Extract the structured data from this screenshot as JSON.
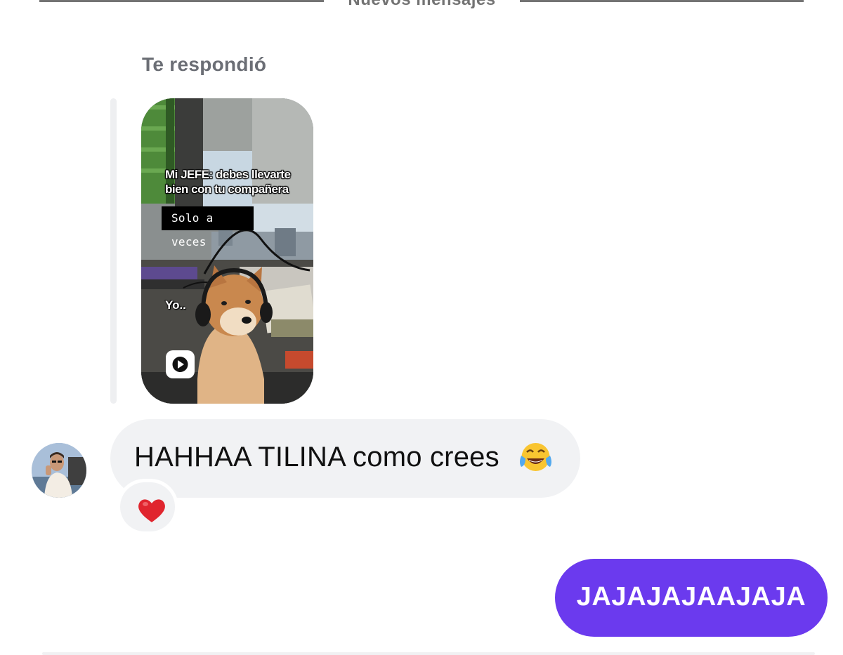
{
  "divider": {
    "label": "Nuevos mensajes"
  },
  "reply": {
    "label": "Te respondió",
    "reel": {
      "caption_line1": "Mi JEFE: debes llevarte",
      "caption_line2": "bien con tu compañera",
      "overlay_text": "Solo a veces",
      "yo_text": "Yo..",
      "play_icon": "play-icon"
    }
  },
  "incoming": {
    "text": "HAHHAA TILINA como crees",
    "emoji": "face-with-tears-of-joy-icon",
    "reaction": "red-heart-icon"
  },
  "outgoing": {
    "text": "JAJAJAJAAJAJA"
  },
  "colors": {
    "outgoing_bubble": "#6b3aee",
    "incoming_bubble": "#f1f2f4",
    "muted_text": "#737373"
  }
}
